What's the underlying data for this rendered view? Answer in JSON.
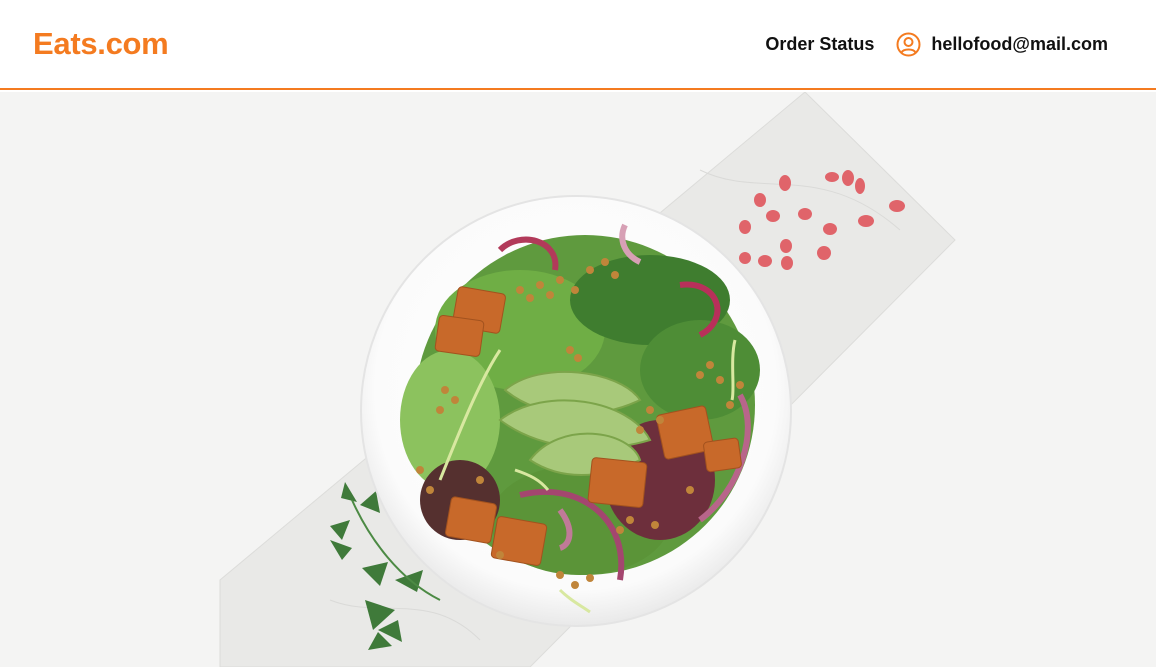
{
  "header": {
    "logo_text": "Eats.com",
    "nav": {
      "order_status_label": "Order Status"
    },
    "account": {
      "icon": "user-circle-icon",
      "email": "hellofood@mail.com"
    }
  },
  "hero": {
    "image": "salad-bowl-photo"
  },
  "colors": {
    "accent": "#f47b20",
    "text": "#111111",
    "hero_background": "#f4f4f3"
  }
}
